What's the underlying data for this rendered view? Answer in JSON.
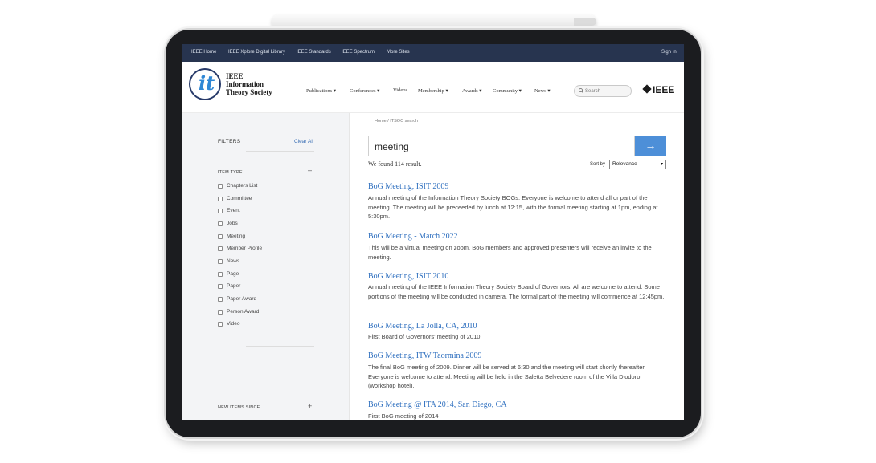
{
  "topbar": {
    "links": [
      "IEEE Home",
      "IEEE Xplore Digital Library",
      "IEEE Standards",
      "IEEE Spectrum",
      "More Sites"
    ],
    "sign_in": "Sign In"
  },
  "header": {
    "logo_letters": "it",
    "society_name": [
      "IEEE",
      "Information",
      "Theory Society"
    ],
    "nav": [
      "Publications ▾",
      "Conferences ▾",
      "Videos",
      "Membership ▾",
      "Awards ▾",
      "Community ▾",
      "News ▾"
    ],
    "search_placeholder": "Search",
    "ieee_logo": "IEEE"
  },
  "sidebar": {
    "filters_title": "FILTERS",
    "clear_all": "Clear All",
    "item_type_title": "ITEM TYPE",
    "item_type_toggle": "–",
    "item_types": [
      "Chapters List",
      "Committee",
      "Event",
      "Jobs",
      "Meeting",
      "Member Profile",
      "News",
      "Page",
      "Paper",
      "Paper Award",
      "Person Award",
      "Video"
    ],
    "new_items_title": "NEW ITEMS SINCE",
    "new_items_toggle": "+"
  },
  "main": {
    "breadcrumb": "Home  /  ITSOC search",
    "query": "meeting",
    "submit_arrow": "→",
    "found_text": "We found 114 result.",
    "sort_label": "Sort by",
    "sort_value": "Relevance",
    "results": [
      {
        "title": "BoG Meeting, ISIT 2009",
        "desc": "Annual meeting of the Information Theory Society BOGs. Everyone is welcome to attend all or part of the meeting. The meeting will be preceeded by lunch at 12:15, with the formal meeting starting at 1pm, ending at 5:30pm."
      },
      {
        "title": "BoG Meeting - March 2022",
        "desc": "This will be a virtual meeting on zoom. BoG members and approved presenters will receive an invite to the meeting."
      },
      {
        "title": "BoG Meeting, ISIT 2010",
        "desc": "Annual meeting of the IEEE Information Theory Society Board of Governors. All are welcome to attend. Some portions of the meeting will be conducted in camera. The formal part of the meeting will commence at 12:45pm."
      },
      {
        "title": "BoG Meeting, La Jolla, CA, 2010",
        "desc": "First Board of Governors' meeting of 2010."
      },
      {
        "title": "BoG Meeting, ITW Taormina 2009",
        "desc": "The final BoG meeting of 2009. Dinner will be served at 6:30 and the meeting will start shortly thereafter. Everyone is welcome to attend. Meeting will be held in the Saletta Belvedere room of the Villa Diodoro (workshop hotel)."
      },
      {
        "title": "BoG Meeting @ ITA 2014, San Diego, CA",
        "desc": "First BoG meeting of 2014"
      }
    ]
  }
}
